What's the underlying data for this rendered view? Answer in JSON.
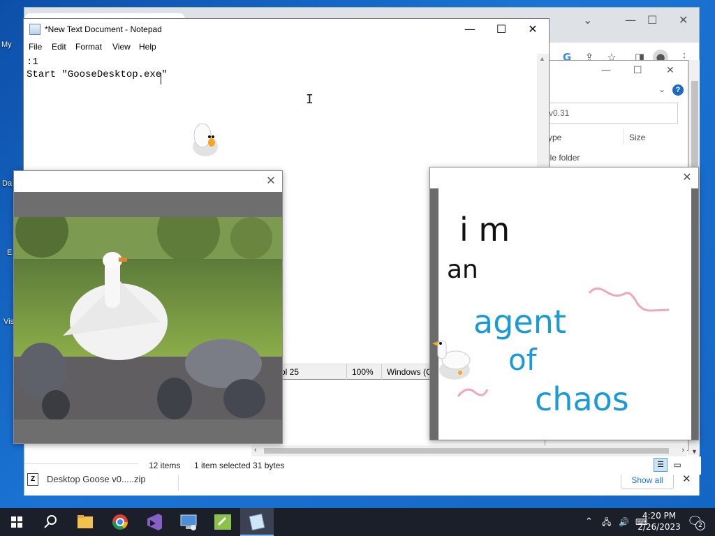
{
  "desktop": {
    "icon_labels": [
      "My",
      "Da",
      "E",
      "Vis"
    ]
  },
  "chrome": {
    "download_item": "Desktop Goose v0.....zip",
    "show_all": "Show all"
  },
  "explorer": {
    "search_text": "v0.31",
    "col_type": "ype",
    "col_size": "Size",
    "row1_type": "ile folder",
    "status_items": "12 items",
    "status_selected": "1 item selected  31 bytes"
  },
  "notepad": {
    "title": "*New Text Document - Notepad",
    "menu": [
      "File",
      "Edit",
      "Format",
      "View",
      "Help"
    ],
    "content": ":1\nStart \"GooseDesktop.exe\"",
    "status_position": "ol 25",
    "status_zoom": "100%",
    "status_encoding": "Windows (C"
  },
  "note_window": {
    "line1": "i m",
    "line2": "an",
    "line3": "agent",
    "line4": "of",
    "line5": "chaos"
  },
  "taskbar": {
    "time": "4:20 PM",
    "date": "2/26/2023",
    "notifications": "2"
  }
}
